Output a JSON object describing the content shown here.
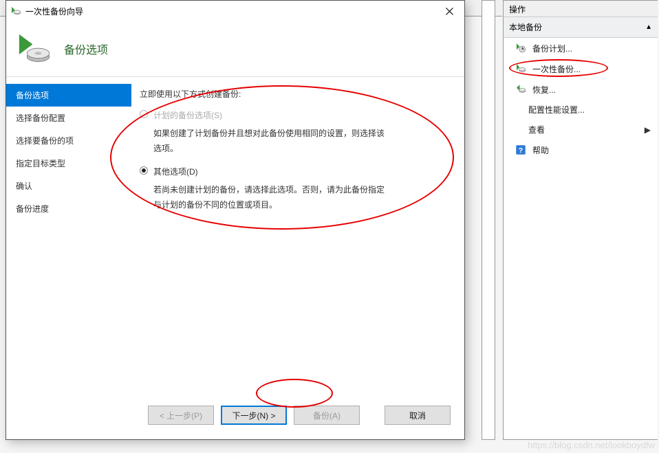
{
  "wizard": {
    "title": "一次性备份向导",
    "header_title": "备份选项",
    "steps": [
      {
        "label": "备份选项",
        "active": true
      },
      {
        "label": "选择备份配置",
        "active": false
      },
      {
        "label": "选择要备份的项",
        "active": false
      },
      {
        "label": "指定目标类型",
        "active": false
      },
      {
        "label": "确认",
        "active": false
      },
      {
        "label": "备份进度",
        "active": false
      }
    ],
    "content": {
      "prompt": "立即使用以下方式创建备份:",
      "option1": {
        "label": "计划的备份选项(S)",
        "desc": "如果创建了计划备份并且想对此备份使用相同的设置，则选择该选项。",
        "enabled": false,
        "selected": false
      },
      "option2": {
        "label": "其他选项(D)",
        "desc": "若尚未创建计划的备份，请选择此选项。否则，请为此备份指定与计划的备份不同的位置或项目。",
        "enabled": true,
        "selected": true
      }
    },
    "buttons": {
      "prev": "< 上一步(P)",
      "next": "下一步(N) >",
      "backup": "备份(A)",
      "cancel": "取消"
    }
  },
  "actions": {
    "title": "操作",
    "section": "本地备份",
    "items": [
      {
        "icon": "schedule",
        "label": "备份计划..."
      },
      {
        "icon": "once",
        "label": "一次性备份..."
      },
      {
        "icon": "recover",
        "label": "恢复..."
      },
      {
        "icon": "none",
        "label": "配置性能设置...",
        "indent": true
      },
      {
        "icon": "none",
        "label": "查看",
        "indent": true,
        "submenu": true
      },
      {
        "icon": "help",
        "label": "帮助"
      }
    ]
  },
  "watermark": "https://blog.csdn.net/lookboydfw"
}
